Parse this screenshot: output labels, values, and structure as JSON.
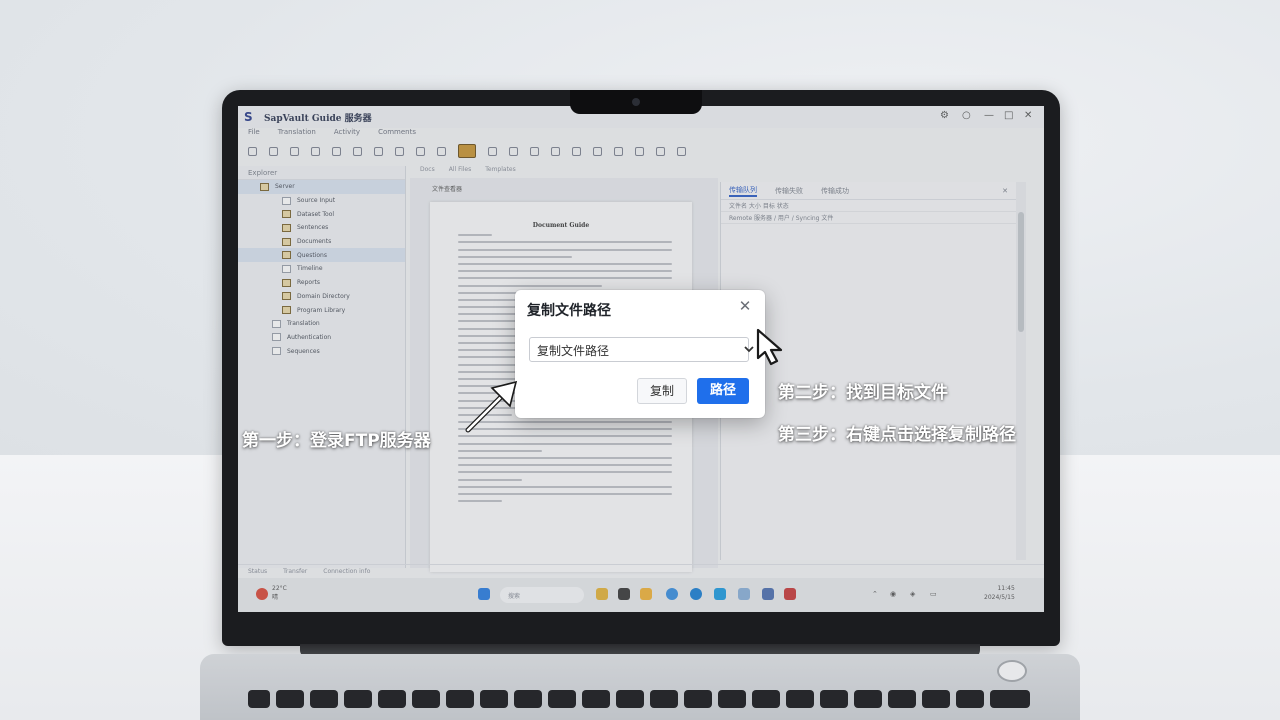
{
  "window": {
    "title": "SapVault Guide 服务器",
    "logo": "S",
    "menu": [
      "File",
      "Translation",
      "Activity",
      "Comments"
    ]
  },
  "sidebar": {
    "header": "Explorer",
    "items": [
      {
        "label": "Server",
        "icon": "folder-icon",
        "selected": true
      },
      {
        "label": "Source Input",
        "icon": "file-icon"
      },
      {
        "label": "Dataset Tool",
        "icon": "folder-icon"
      },
      {
        "label": "Sentences",
        "icon": "folder-icon"
      },
      {
        "label": "Documents",
        "icon": "folder-icon"
      },
      {
        "label": "Questions",
        "icon": "folder-icon",
        "selected": true
      },
      {
        "label": "Timeline",
        "icon": "file-icon"
      },
      {
        "label": "Reports",
        "icon": "folder-icon"
      },
      {
        "label": "Domain Directory",
        "icon": "folder-icon"
      },
      {
        "label": "Program Library",
        "icon": "folder-icon"
      },
      {
        "label": "Translation",
        "icon": "file-icon"
      },
      {
        "label": "Authentication",
        "icon": "file-icon"
      },
      {
        "label": "Sequences",
        "icon": "file-icon"
      }
    ]
  },
  "doc": {
    "tabs": [
      "Docs",
      "All Files",
      "Templates"
    ],
    "breadcrumb": "文件查看器",
    "page_title": "Document Guide"
  },
  "right_panel": {
    "tabs": [
      "传输队列",
      "传输失败",
      "传输成功"
    ],
    "row_header": "文件名 大小 目标 状态",
    "row_value": "Remote 服务器 / 用户 / Syncing 文件"
  },
  "statusbar": [
    "Status",
    "Transfer",
    "Connection info"
  ],
  "taskbar": {
    "search_placeholder": "搜索",
    "weather_temp": "22°C",
    "weather_desc": "晴",
    "time": "11:45",
    "date": "2024/5/15"
  },
  "dialog": {
    "title": "复制文件路径",
    "select_value": "复制文件路径",
    "copy_button": "复制",
    "path_button": "路径"
  },
  "annotations": {
    "step1": "第一步：登录FTP服务器",
    "step2": "第二步：找到目标文件",
    "step3": "第三步：右键点击选择复制路径"
  },
  "colors": {
    "accent": "#1f6feb",
    "annotation_text": "#ffffff",
    "folder": "#c79434"
  }
}
